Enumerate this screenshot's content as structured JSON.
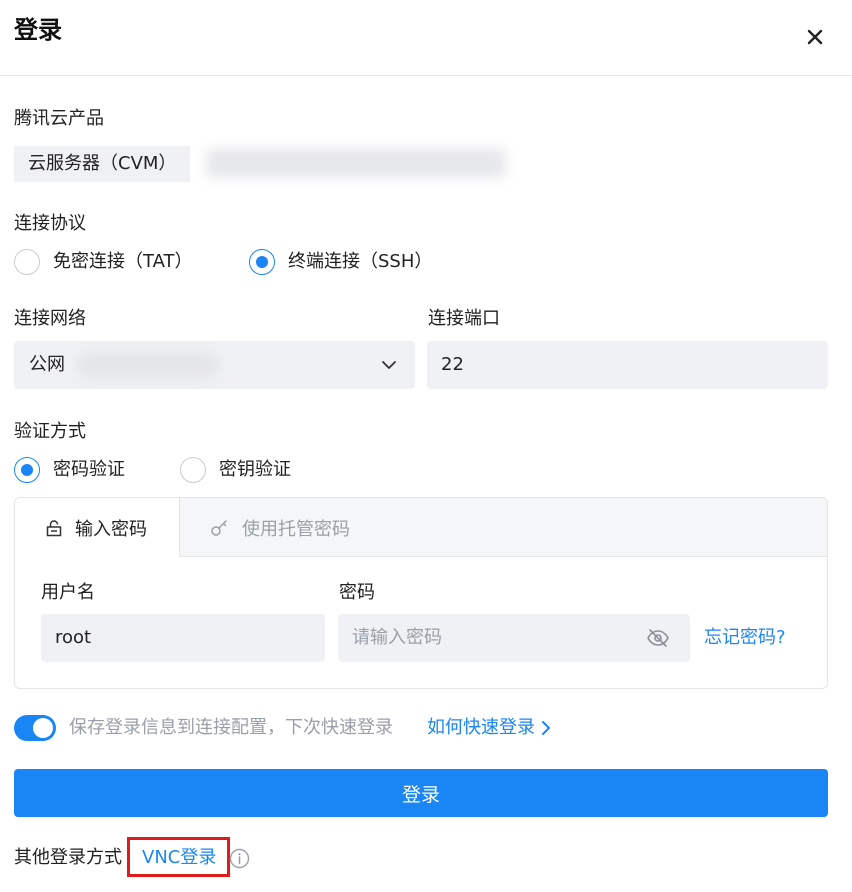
{
  "header": {
    "title": "登录",
    "close_icon": "close-icon"
  },
  "product": {
    "label": "腾讯云产品",
    "tag": "云服务器（CVM）"
  },
  "protocol": {
    "label": "连接协议",
    "options": [
      {
        "label": "免密连接（TAT）",
        "checked": false
      },
      {
        "label": "终端连接（SSH）",
        "checked": true
      }
    ]
  },
  "network": {
    "label": "连接网络",
    "value": "公网"
  },
  "port": {
    "label": "连接端口",
    "value": "22"
  },
  "auth": {
    "label": "验证方式",
    "options": [
      {
        "label": "密码验证",
        "checked": true
      },
      {
        "label": "密钥验证",
        "checked": false
      }
    ]
  },
  "tabs": [
    {
      "label": "输入密码",
      "icon": "lock-icon",
      "active": true
    },
    {
      "label": "使用托管密码",
      "icon": "key-icon",
      "active": false
    }
  ],
  "credentials": {
    "username_label": "用户名",
    "username_value": "root",
    "password_label": "密码",
    "password_placeholder": "请输入密码",
    "forgot_link": "忘记密码?"
  },
  "save": {
    "enabled": true,
    "text": "保存登录信息到连接配置，下次快速登录",
    "link": "如何快速登录"
  },
  "login_button": "登录",
  "other": {
    "label": "其他登录方式",
    "vnc_link": "VNC登录"
  },
  "colors": {
    "accent": "#1a86f5",
    "highlight_border": "#e01b1b",
    "field_bg": "#f0f1f4"
  }
}
